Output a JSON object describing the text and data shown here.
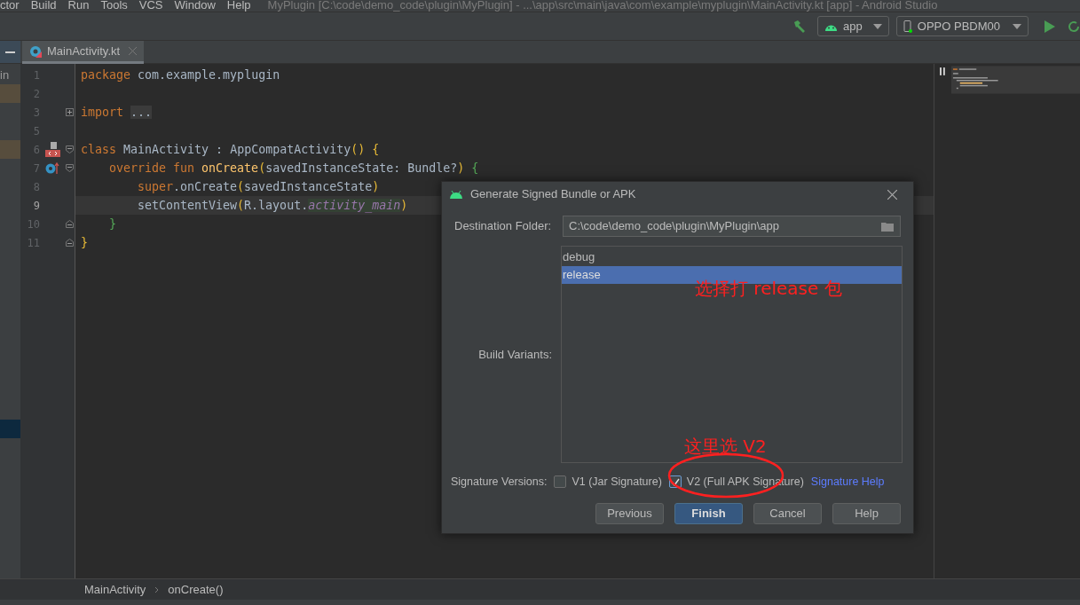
{
  "menu_bar": {
    "items": [
      "ctor",
      "Build",
      "Run",
      "Tools",
      "VCS",
      "Window",
      "Help"
    ],
    "title": "MyPlugin [C:\\code\\demo_code\\plugin\\MyPlugin] - ...\\app\\src\\main\\java\\com\\example\\myplugin\\MainActivity.kt [app] - Android Studio"
  },
  "toolbar": {
    "config": "app",
    "device": "OPPO PBDM00"
  },
  "tabs": [
    {
      "label": "MainActivity.kt",
      "selected": true
    }
  ],
  "project_panel": [
    {
      "kind": "text",
      "text": "in"
    },
    {
      "kind": "modified"
    },
    {
      "kind": "blank"
    },
    {
      "kind": "blank"
    },
    {
      "kind": "modified"
    },
    {
      "kind": "blank"
    },
    {
      "kind": "blank"
    },
    {
      "kind": "blank"
    },
    {
      "kind": "blank"
    },
    {
      "kind": "blank"
    },
    {
      "kind": "blank"
    },
    {
      "kind": "blank"
    },
    {
      "kind": "blank"
    },
    {
      "kind": "blank"
    },
    {
      "kind": "blank"
    },
    {
      "kind": "blank"
    },
    {
      "kind": "blank"
    },
    {
      "kind": "blank"
    },
    {
      "kind": "blank"
    },
    {
      "kind": "selected"
    }
  ],
  "code_lines": [
    {
      "number": "1",
      "tokens": [
        {
          "kind": "keyword",
          "text": "package "
        },
        {
          "kind": "plain",
          "text": "com.example.myplugin"
        }
      ]
    },
    {
      "number": "2"
    },
    {
      "number": "3",
      "fold_marker": {
        "kind": "expand"
      },
      "tokens": [
        {
          "kind": "keyword",
          "text": "import "
        },
        {
          "kind": "folded",
          "text": "..."
        }
      ]
    },
    {
      "number": "5"
    },
    {
      "number": "6",
      "fold_marker": {
        "kind": "collapse"
      },
      "gutter_icon": {
        "kind": "layout"
      },
      "tokens": [
        {
          "kind": "keyword",
          "text": "class "
        },
        {
          "kind": "plain",
          "text": "MainActivity : AppCompatActivity"
        },
        {
          "kind": "paren",
          "text": "() {"
        }
      ],
      "children": [
        {
          "number": "7",
          "fold_marker": {
            "kind": "collapse"
          },
          "gutter_icon": {
            "kind": "override"
          },
          "tokens": [
            {
              "kind": "keyword",
              "text": "override fun "
            },
            {
              "kind": "function",
              "text": "onCreate"
            },
            {
              "kind": "paren",
              "text": "("
            },
            {
              "kind": "plain",
              "text": "savedInstanceState: Bundle?"
            },
            {
              "kind": "paren",
              "text": ") "
            },
            {
              "kind": "brace",
              "text": "{"
            }
          ],
          "children": [
            {
              "number": "8",
              "tokens": [
                {
                  "kind": "keyword",
                  "text": "super"
                },
                {
                  "kind": "plain",
                  "text": ".onCreate"
                },
                {
                  "kind": "paren",
                  "text": "("
                },
                {
                  "kind": "plain",
                  "text": "savedInstanceState"
                },
                {
                  "kind": "paren",
                  "text": ")"
                }
              ]
            },
            {
              "number": "9",
              "current": true,
              "tokens": [
                {
                  "kind": "plain",
                  "text": "setContentView"
                },
                {
                  "kind": "paren",
                  "text": "("
                },
                {
                  "kind": "plain",
                  "text": "R.layout."
                },
                {
                  "kind": "field",
                  "text": "activity_main"
                },
                {
                  "kind": "paren",
                  "text": ")"
                }
              ]
            }
          ]
        },
        {
          "number": "10",
          "fold_marker": {
            "kind": "end"
          },
          "tokens": [
            {
              "kind": "brace",
              "text": "}"
            }
          ]
        }
      ]
    },
    {
      "number": "11",
      "fold_marker": {
        "kind": "end"
      },
      "tokens": [
        {
          "kind": "paren",
          "text": "}"
        }
      ]
    }
  ],
  "breadcrumbs": [
    "MainActivity",
    "onCreate()"
  ],
  "dialog": {
    "title": "Generate Signed Bundle or APK",
    "destination_label": "Destination Folder:",
    "destination_value": "C:\\code\\demo_code\\plugin\\MyPlugin\\app",
    "variants_label": "Build Variants:",
    "variants": [
      {
        "label": "debug",
        "selected": false
      },
      {
        "label": "release",
        "selected": true
      }
    ],
    "signature_label": "Signature Versions:",
    "signatures": [
      {
        "label": "V1 (Jar Signature)",
        "checked": false
      },
      {
        "label": "V2 (Full APK Signature)",
        "checked": true
      }
    ],
    "help_link": "Signature Help",
    "buttons": [
      {
        "label": "Previous",
        "default": false
      },
      {
        "label": "Finish",
        "default": true
      },
      {
        "label": "Cancel",
        "default": false
      },
      {
        "label": "Help",
        "default": false
      }
    ]
  },
  "annotations": [
    {
      "kind": "text",
      "text": "选择打 release 包"
    },
    {
      "kind": "text",
      "text": "这里选 V2"
    },
    {
      "kind": "ellipse"
    }
  ]
}
